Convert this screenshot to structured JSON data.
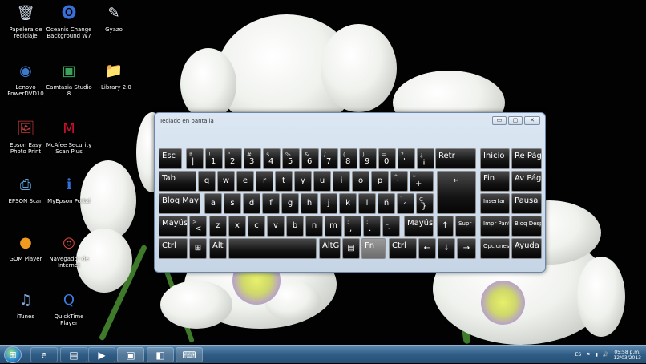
{
  "desktop_icons": [
    {
      "label": "Papelera de reciclaje",
      "icon": "recycle-bin-icon",
      "glyph": "🗑"
    },
    {
      "label": "Oceanis Change Background W7",
      "icon": "oceanis-icon",
      "glyph": "🅞"
    },
    {
      "label": "Gyazo",
      "icon": "gyazo-icon",
      "glyph": "✎"
    },
    {
      "label": "Lenovo PowerDVD10",
      "icon": "powerdvd-icon",
      "glyph": "◉"
    },
    {
      "label": "Camtasia Studio 8",
      "icon": "camtasia-icon",
      "glyph": "▣"
    },
    {
      "label": "~Library 2.0",
      "icon": "folder-icon",
      "glyph": "📁"
    },
    {
      "label": "Epson Easy Photo Print",
      "icon": "epson-photo-icon",
      "glyph": "🖼"
    },
    {
      "label": "McAfee Security Scan Plus",
      "icon": "mcafee-icon",
      "glyph": "M"
    },
    {
      "label": "EPSON Scan",
      "icon": "epson-scan-icon",
      "glyph": "⎙"
    },
    {
      "label": "MyEpson Portal",
      "icon": "myepson-icon",
      "glyph": "ℹ"
    },
    {
      "label": "GOM Player",
      "icon": "gom-player-icon",
      "glyph": "●"
    },
    {
      "label": "Navegador de Internet",
      "icon": "chrome-icon",
      "glyph": "◎"
    },
    {
      "label": "iTunes",
      "icon": "itunes-icon",
      "glyph": "♫"
    },
    {
      "label": "QuickTime Player",
      "icon": "quicktime-icon",
      "glyph": "Q"
    }
  ],
  "osk": {
    "title": "Teclado en pantalla",
    "minimize": "▭",
    "maximize": "▢",
    "close": "✕",
    "keys": [
      {
        "id": "esc",
        "label": "Esc"
      },
      {
        "id": "k1",
        "top": "ª",
        "label": "|"
      },
      {
        "id": "k2",
        "top": "!",
        "label": "1"
      },
      {
        "id": "k3",
        "top": "\"",
        "label": "2"
      },
      {
        "id": "k4",
        "top": "#",
        "label": "3"
      },
      {
        "id": "k5",
        "top": "$",
        "label": "4"
      },
      {
        "id": "k6",
        "top": "%",
        "label": "5"
      },
      {
        "id": "k7",
        "top": "&",
        "label": "6"
      },
      {
        "id": "k8",
        "top": "/",
        "label": "7"
      },
      {
        "id": "k9",
        "top": "(",
        "label": "8"
      },
      {
        "id": "k10",
        "top": ")",
        "label": "9"
      },
      {
        "id": "k11",
        "top": "=",
        "label": "0"
      },
      {
        "id": "k12",
        "top": "?",
        "label": "'"
      },
      {
        "id": "k13",
        "top": "¿",
        "label": "¡"
      },
      {
        "id": "retr",
        "label": "Retr"
      },
      {
        "id": "tab",
        "label": "Tab"
      },
      {
        "id": "q",
        "label": "q"
      },
      {
        "id": "w",
        "label": "w"
      },
      {
        "id": "e",
        "label": "e"
      },
      {
        "id": "r",
        "label": "r"
      },
      {
        "id": "t",
        "label": "t"
      },
      {
        "id": "y",
        "label": "y"
      },
      {
        "id": "u",
        "label": "u"
      },
      {
        "id": "i",
        "label": "i"
      },
      {
        "id": "o",
        "label": "o"
      },
      {
        "id": "p",
        "label": "p"
      },
      {
        "id": "acc",
        "top": "^",
        "label": "`"
      },
      {
        "id": "plus",
        "top": "*",
        "label": "+"
      },
      {
        "id": "enter",
        "label": "↵"
      },
      {
        "id": "bloqmay",
        "label": "Bloq May"
      },
      {
        "id": "a",
        "label": "a"
      },
      {
        "id": "s",
        "label": "s"
      },
      {
        "id": "d",
        "label": "d"
      },
      {
        "id": "f",
        "label": "f"
      },
      {
        "id": "g",
        "label": "g"
      },
      {
        "id": "h",
        "label": "h"
      },
      {
        "id": "j",
        "label": "j"
      },
      {
        "id": "k",
        "label": "k"
      },
      {
        "id": "l",
        "label": "l"
      },
      {
        "id": "ntilde",
        "label": "ñ"
      },
      {
        "id": "diaer",
        "top": "¨",
        "label": "´"
      },
      {
        "id": "cced",
        "top": "Ç",
        "label": "}"
      },
      {
        "id": "lshift",
        "label": "Mayús"
      },
      {
        "id": "lt",
        "top": ">",
        "label": "<"
      },
      {
        "id": "z",
        "label": "z"
      },
      {
        "id": "x",
        "label": "x"
      },
      {
        "id": "c",
        "label": "c"
      },
      {
        "id": "v",
        "label": "v"
      },
      {
        "id": "b",
        "label": "b"
      },
      {
        "id": "n",
        "label": "n"
      },
      {
        "id": "m",
        "label": "m"
      },
      {
        "id": "comma",
        "top": ";",
        "label": ","
      },
      {
        "id": "period",
        "top": ":",
        "label": "."
      },
      {
        "id": "dash",
        "top": "_",
        "label": "-"
      },
      {
        "id": "rshift",
        "label": "Mayús"
      },
      {
        "id": "up",
        "label": "↑"
      },
      {
        "id": "supr",
        "label": "Supr"
      },
      {
        "id": "lctrl",
        "label": "Ctrl"
      },
      {
        "id": "win",
        "label": "⊞"
      },
      {
        "id": "alt",
        "label": "Alt"
      },
      {
        "id": "space",
        "label": ""
      },
      {
        "id": "altgr",
        "label": "AltGr"
      },
      {
        "id": "menu",
        "label": "▤"
      },
      {
        "id": "fn",
        "label": "Fn"
      },
      {
        "id": "rctrl",
        "label": "Ctrl"
      },
      {
        "id": "left",
        "label": "←"
      },
      {
        "id": "down",
        "label": "↓"
      },
      {
        "id": "right",
        "label": "→"
      },
      {
        "id": "inicio",
        "label": "Inicio"
      },
      {
        "id": "repag",
        "label": "Re Pág"
      },
      {
        "id": "fin",
        "label": "Fin"
      },
      {
        "id": "avpag",
        "label": "Av Pág"
      },
      {
        "id": "insertar",
        "label": "Insertar"
      },
      {
        "id": "pausa",
        "label": "Pausa"
      },
      {
        "id": "imprpant",
        "label": "Impr Pant"
      },
      {
        "id": "bloqdespl",
        "label": "Bloq Despl"
      },
      {
        "id": "opciones",
        "label": "Opciones"
      },
      {
        "id": "ayuda",
        "label": "Ayuda"
      }
    ]
  },
  "taskbar": {
    "start_glyph": "⊞",
    "items": [
      {
        "name": "internet-explorer-icon",
        "glyph": "e"
      },
      {
        "name": "file-explorer-icon",
        "glyph": "▤"
      },
      {
        "name": "media-player-icon",
        "glyph": "▶"
      },
      {
        "name": "camtasia-task-icon",
        "glyph": "▣"
      },
      {
        "name": "camtasia-recorder-icon",
        "glyph": "◧"
      },
      {
        "name": "keyboard-task-icon",
        "glyph": "⌨"
      }
    ],
    "tray": {
      "lang": "ES",
      "time": "05:58 p.m.",
      "date": "12/03/2013"
    }
  }
}
